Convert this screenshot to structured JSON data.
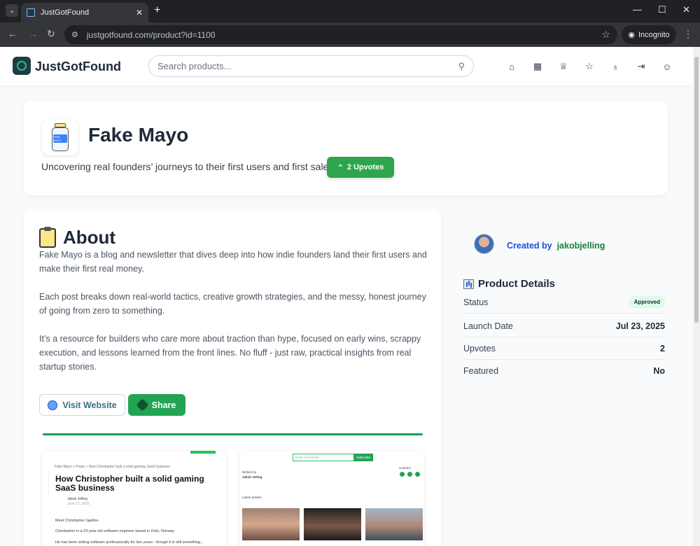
{
  "browser": {
    "tab_title": "JustGotFound",
    "url": "justgotfound.com/product?id=1100",
    "incognito_label": "Incognito"
  },
  "site": {
    "logo_text": "JustGotFound",
    "search_placeholder": "Search products...",
    "nav_icons": [
      "home-icon",
      "grid-icon",
      "award-icon",
      "star-icon",
      "lightbulb-icon",
      "login-icon",
      "users-icon"
    ]
  },
  "product": {
    "name": "Fake Mayo",
    "logo_label": "FAKE MAYO",
    "tagline": "Uncovering real founders’ journeys to their first users and first sales.",
    "upvote_label": "2 Upvotes"
  },
  "about": {
    "heading": "About",
    "paragraphs": [
      "Fake Mayo is a blog and newsletter that dives deep into how indie founders land their first users and make their first real money.",
      "Each post breaks down real-world tactics, creative growth strategies, and the messy, honest journey of going from zero to something.",
      "It’s a resource for builders who care more about traction than hype, focused on early wins, scrappy execution, and lessons learned from the front lines. No fluff - just raw, practical insights from real startup stories."
    ],
    "visit_label": "Visit Website",
    "share_label": "Share"
  },
  "screenshots": {
    "shot1": {
      "breadcrumb": "Fake Mayo  >  Posts  >  How Christopher built a solid gaming SaaS business",
      "title": "How Christopher built a solid gaming SaaS business",
      "author": "Jakob Jelling",
      "date": "June 17, 2025",
      "p1": "Meet Christopher Gjølme.",
      "p2": "Christopher is a 23-year old software engineer based in Oslo, Norway.",
      "p3": "He has been writing software professionally for two years - though it is still something..."
    },
    "shot2": {
      "email_placeholder": "Enter Your Email",
      "subscribe_label": "Subscribe",
      "written_by": "Written by",
      "author_name": "Jakob Jelling",
      "connect": "Connect",
      "latest": "Latest articles"
    }
  },
  "sidebar": {
    "created_by_label": "Created by",
    "creator": "jakobjelling",
    "details_heading": "Product Details",
    "rows": [
      {
        "label": "Status",
        "value": "Approved"
      },
      {
        "label": "Launch Date",
        "value": "Jul 23, 2025"
      },
      {
        "label": "Upvotes",
        "value": "2"
      },
      {
        "label": "Featured",
        "value": "No"
      }
    ]
  }
}
